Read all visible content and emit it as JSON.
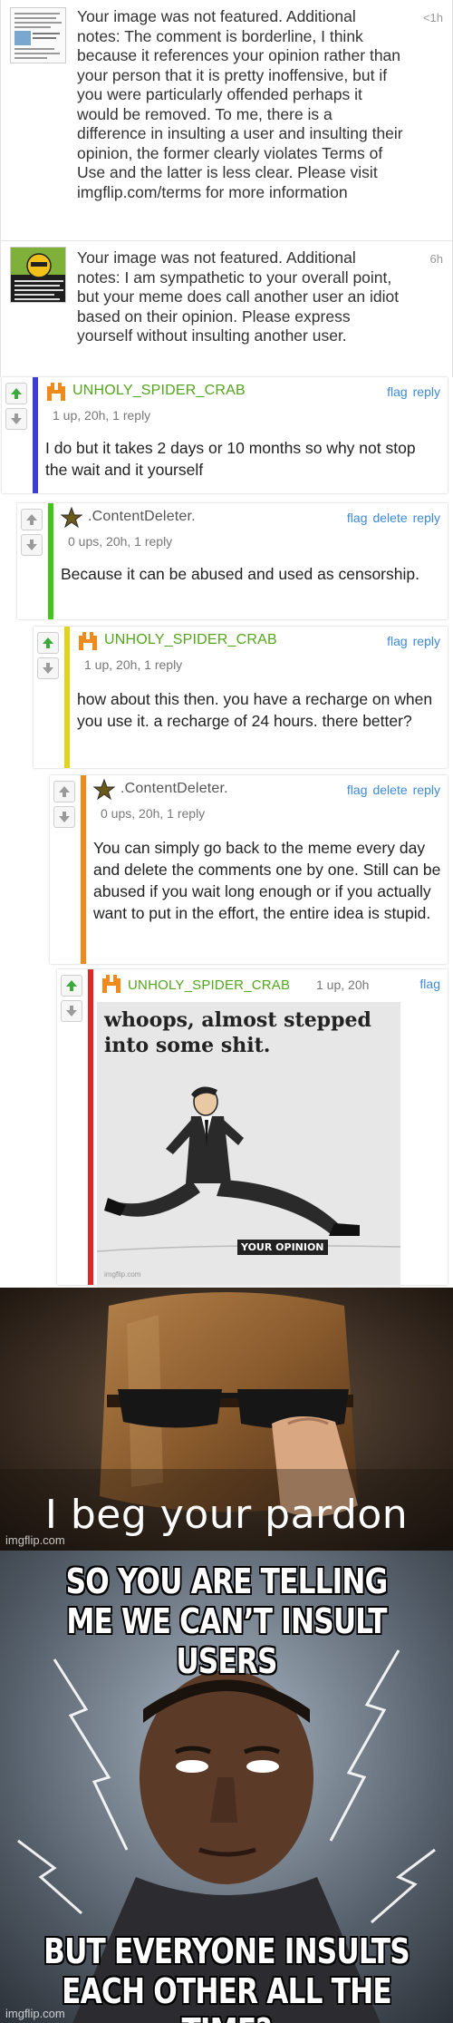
{
  "notifications": [
    {
      "message": "Your image was not featured. Additional notes: The comment is borderline, I think because it references your opinion rather than your person that it is pretty inoffensive, but if you were particularly offended perhaps it would be removed. To me, there is a difference in insulting a user and insulting their opinion, the former clearly violates Terms of Use and the latter is less clear. Please visit imgflip.com/terms for more information",
      "time": "<1h"
    },
    {
      "message": "Your image was not featured. Additional notes: I am sympathetic to your overall point, but your meme does call another user an idiot based on their opinion. Please express yourself without insulting another user.",
      "time": "6h"
    }
  ],
  "comments": [
    {
      "username": "UNHOLY_SPIDER_CRAB",
      "meta": "1 up, 20h, 1 reply",
      "actions": [
        "flag",
        "reply"
      ],
      "text": "I do but it takes 2 days or 10 months so why not stop the wait and it yourself",
      "bar_color": "#3b3fd6"
    },
    {
      "username": ".ContentDeleter.",
      "meta": "0 ups, 20h, 1 reply",
      "actions": [
        "flag",
        "delete",
        "reply"
      ],
      "text": "Because it can be abused and used as censorship.",
      "bar_color": "#43c51b"
    },
    {
      "username": "UNHOLY_SPIDER_CRAB",
      "meta": "1 up, 20h, 1 reply",
      "actions": [
        "flag",
        "reply"
      ],
      "text": "how about this then. you have a recharge on when you use it. a recharge of 24 hours. there better?",
      "bar_color": "#e2d41c"
    },
    {
      "username": ".ContentDeleter.",
      "meta": "0 ups, 20h, 1 reply",
      "actions": [
        "flag",
        "delete",
        "reply"
      ],
      "text": "You can simply go back to the meme every day and delete the comments one by one. Still can be abused if you wait long enough or if you actually want to put in the effort, the entire idea is stupid.",
      "bar_color": "#f08a1a"
    },
    {
      "username": "UNHOLY_SPIDER_CRAB",
      "meta": "1 up, 20h",
      "actions": [
        "flag"
      ],
      "bar_color": "#e32626",
      "meme": {
        "top_text": "whoops, almost stepped into some shit.",
        "label": "YOUR OPINION",
        "watermark": "imgflip.com"
      }
    }
  ],
  "meme_pardon": {
    "caption": "I beg your pardon",
    "watermark": "imgflip.com"
  },
  "meme_lightning": {
    "top_text": "SO YOU ARE TELLING ME WE CAN’T INSULT USERS",
    "bottom_text": "BUT EVERYONE INSULTS EACH OTHER ALL THE TIME?",
    "watermark": "imgflip.com"
  },
  "colors": {
    "username_green": "#53a51d",
    "link_blue": "#3c8ad8",
    "upvote_green": "#3da83d"
  }
}
